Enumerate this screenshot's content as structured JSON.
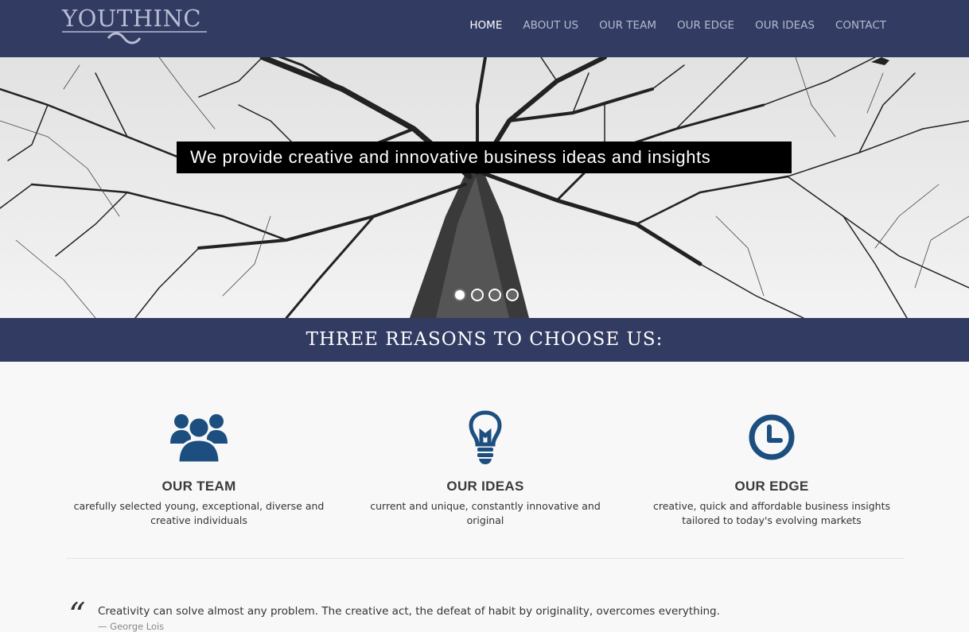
{
  "brand": {
    "logo_text": "YOUTHINC"
  },
  "nav": {
    "items": [
      {
        "label": "HOME",
        "active": true
      },
      {
        "label": "ABOUT US",
        "active": false
      },
      {
        "label": "OUR TEAM",
        "active": false
      },
      {
        "label": "OUR EDGE",
        "active": false
      },
      {
        "label": "OUR IDEAS",
        "active": false
      },
      {
        "label": "CONTACT",
        "active": false
      }
    ]
  },
  "hero": {
    "caption": "We provide creative and innovative business ideas and insights",
    "slides_count": 4,
    "active_slide": 1
  },
  "band": {
    "title": "THREE REASONS TO CHOOSE US:"
  },
  "features": [
    {
      "icon": "team-icon",
      "title": "OUR TEAM",
      "text": "carefully selected young, exceptional, diverse and creative individuals"
    },
    {
      "icon": "lightbulb-icon",
      "title": "OUR IDEAS",
      "text": "current and unique, constantly innovative and original"
    },
    {
      "icon": "clock-icon",
      "title": "OUR EDGE",
      "text": "creative, quick and affordable business insights tailored to today's evolving markets"
    }
  ],
  "quote": {
    "mark": "“",
    "text": "Creativity can solve almost any problem. The creative act, the defeat of habit by originality, overcomes everything.",
    "author": "— George Lois"
  },
  "colors": {
    "navy": "#323b62",
    "icon_blue": "#1c4f80",
    "nav_text": "#b4bacf"
  }
}
